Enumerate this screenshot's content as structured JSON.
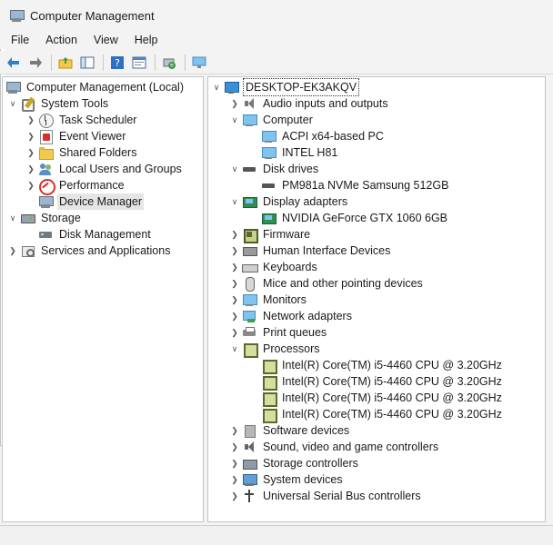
{
  "window": {
    "title": "Computer Management"
  },
  "menu": [
    "File",
    "Action",
    "View",
    "Help"
  ],
  "toolbar": {
    "icons": [
      "back-arrow-icon",
      "forward-arrow-icon",
      "up-folder-icon",
      "show-hide-tree-icon",
      "help-icon",
      "properties-icon",
      "scan-hardware-icon",
      "display-monitor-icon"
    ]
  },
  "left_tree": {
    "root": "Computer Management (Local)",
    "system_tools": "System Tools",
    "task_scheduler": "Task Scheduler",
    "event_viewer": "Event Viewer",
    "shared_folders": "Shared Folders",
    "local_users": "Local Users and Groups",
    "performance": "Performance",
    "device_manager": "Device Manager",
    "storage": "Storage",
    "disk_management": "Disk Management",
    "services": "Services and Applications"
  },
  "device_tree": {
    "root": "DESKTOP-EK3AKQV",
    "audio": "Audio inputs and outputs",
    "computer": "Computer",
    "computer_children": [
      "ACPI x64-based PC",
      "INTEL H81"
    ],
    "disk_drives": "Disk drives",
    "disk_children": [
      "PM981a NVMe Samsung 512GB"
    ],
    "display_adapters": "Display adapters",
    "display_children": [
      "NVIDIA GeForce GTX 1060 6GB"
    ],
    "firmware": "Firmware",
    "hid": "Human Interface Devices",
    "keyboards": "Keyboards",
    "mice": "Mice and other pointing devices",
    "monitors": "Monitors",
    "network": "Network adapters",
    "print_queues": "Print queues",
    "processors": "Processors",
    "processor_children": [
      "Intel(R) Core(TM) i5-4460  CPU @ 3.20GHz",
      "Intel(R) Core(TM) i5-4460  CPU @ 3.20GHz",
      "Intel(R) Core(TM) i5-4460  CPU @ 3.20GHz",
      "Intel(R) Core(TM) i5-4460  CPU @ 3.20GHz"
    ],
    "software_devices": "Software devices",
    "sound": "Sound, video and game controllers",
    "storage_controllers": "Storage controllers",
    "system_devices": "System devices",
    "usb": "Universal Serial Bus controllers"
  }
}
